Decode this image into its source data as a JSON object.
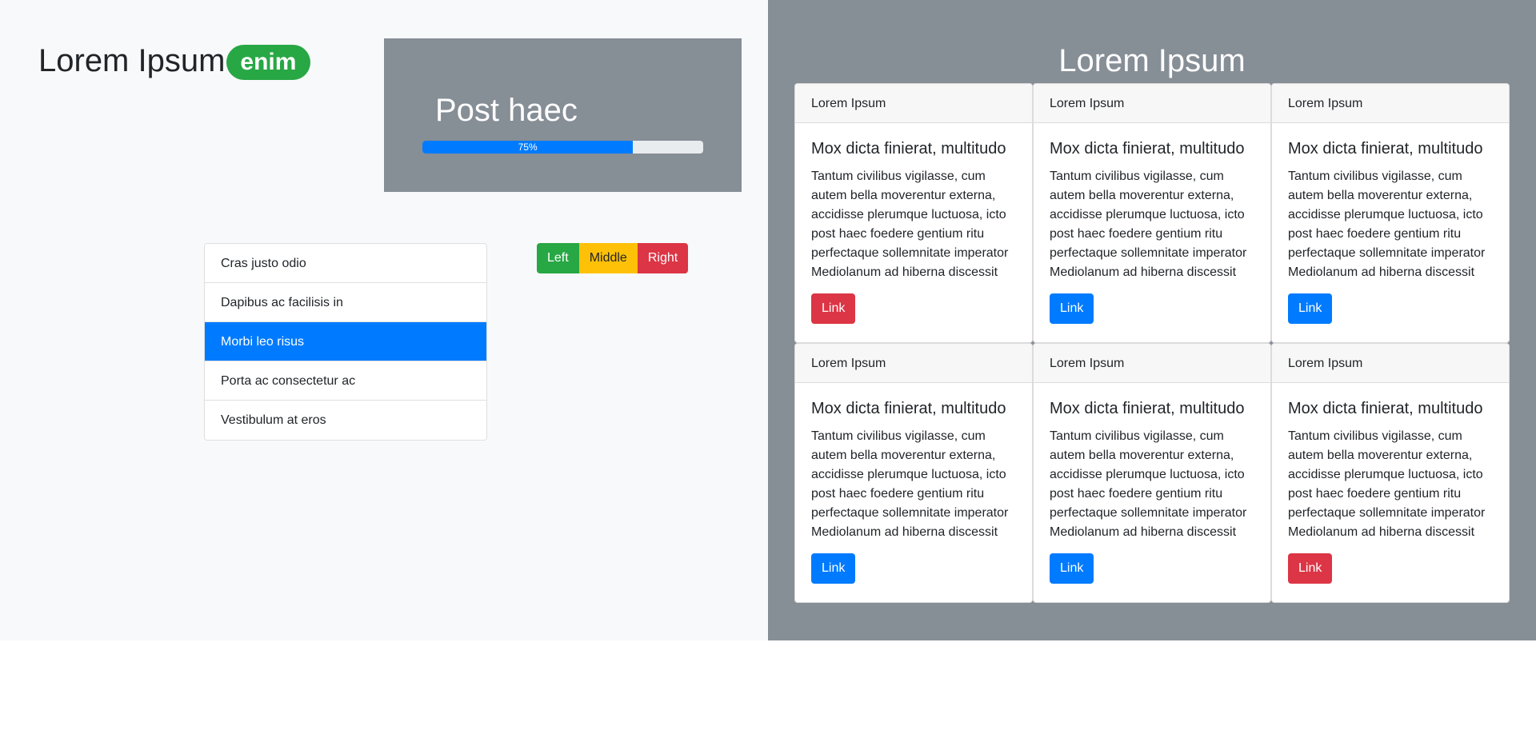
{
  "left": {
    "brand": {
      "title": "Lorem Ipsum",
      "badge": "enim",
      "badge_color": "#28a745"
    },
    "jumbotron": {
      "title": "Post haec",
      "progress_percent": 75,
      "progress_label": "75%"
    },
    "list": {
      "items": [
        {
          "label": "Cras justo odio",
          "active": false
        },
        {
          "label": "Dapibus ac facilisis in",
          "active": false
        },
        {
          "label": "Morbi leo risus",
          "active": true
        },
        {
          "label": "Porta ac consectetur ac",
          "active": false
        },
        {
          "label": "Vestibulum at eros",
          "active": false
        }
      ]
    },
    "button_group": {
      "left": "Left",
      "middle": "Middle",
      "right": "Right"
    }
  },
  "right": {
    "title": "Lorem Ipsum",
    "cards": [
      {
        "header": "Lorem Ipsum",
        "title": "Mox dicta finierat, multitudo",
        "text": "Tantum civilibus vigilasse, cum autem bella moverentur externa, accidisse plerumque luctuosa, icto post haec foedere gentium ritu perfectaque sollemnitate imperator Mediolanum ad hiberna discessit",
        "link": "Link",
        "link_color": "red"
      },
      {
        "header": "Lorem Ipsum",
        "title": "Mox dicta finierat, multitudo",
        "text": "Tantum civilibus vigilasse, cum autem bella moverentur externa, accidisse plerumque luctuosa, icto post haec foedere gentium ritu perfectaque sollemnitate imperator Mediolanum ad hiberna discessit",
        "link": "Link",
        "link_color": "blue"
      },
      {
        "header": "Lorem Ipsum",
        "title": "Mox dicta finierat, multitudo",
        "text": "Tantum civilibus vigilasse, cum autem bella moverentur externa, accidisse plerumque luctuosa, icto post haec foedere gentium ritu perfectaque sollemnitate imperator Mediolanum ad hiberna discessit",
        "link": "Link",
        "link_color": "blue"
      },
      {
        "header": "Lorem Ipsum",
        "title": "Mox dicta finierat, multitudo",
        "text": "Tantum civilibus vigilasse, cum autem bella moverentur externa, accidisse plerumque luctuosa, icto post haec foedere gentium ritu perfectaque sollemnitate imperator Mediolanum ad hiberna discessit",
        "link": "Link",
        "link_color": "blue"
      },
      {
        "header": "Lorem Ipsum",
        "title": "Mox dicta finierat, multitudo",
        "text": "Tantum civilibus vigilasse, cum autem bella moverentur externa, accidisse plerumque luctuosa, icto post haec foedere gentium ritu perfectaque sollemnitate imperator Mediolanum ad hiberna discessit",
        "link": "Link",
        "link_color": "blue"
      },
      {
        "header": "Lorem Ipsum",
        "title": "Mox dicta finierat, multitudo",
        "text": "Tantum civilibus vigilasse, cum autem bella moverentur externa, accidisse plerumque luctuosa, icto post haec foedere gentium ritu perfectaque sollemnitate imperator Mediolanum ad hiberna discessit",
        "link": "Link",
        "link_color": "red"
      }
    ]
  },
  "colors": {
    "primary": "#007bff",
    "success": "#28a745",
    "warning": "#ffc107",
    "danger": "#dc3545",
    "secondary": "#868e96",
    "light": "#f8f9fa"
  }
}
